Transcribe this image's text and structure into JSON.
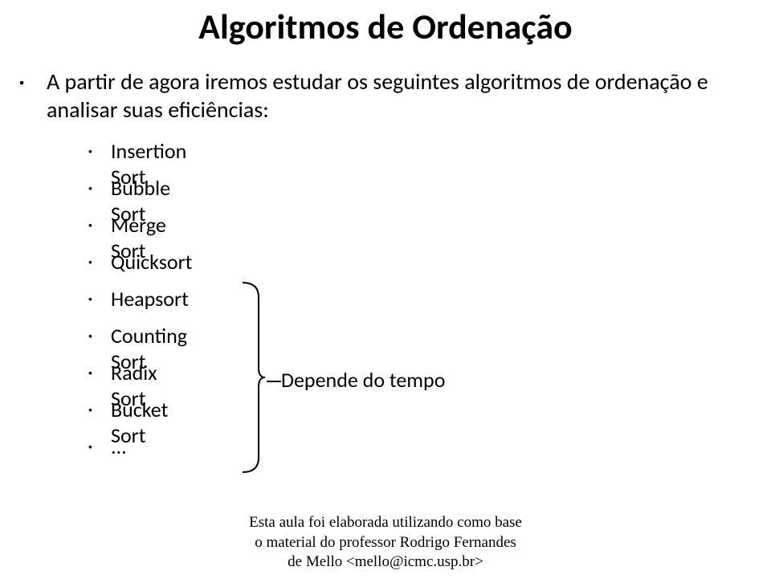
{
  "title": "Algoritmos de Ordenação",
  "intro": "A partir de agora iremos estudar os seguintes algoritmos de ordenação e analisar suas eficiências:",
  "items": [
    "Insertion Sort",
    "Bubble Sort",
    "Merge Sort",
    "Quicksort",
    "Heapsort",
    "Counting Sort",
    "Radix Sort",
    "Bucket Sort",
    "..."
  ],
  "note": "Depende do tempo",
  "footer": {
    "line1": "Esta aula foi elaborada utilizando como base",
    "line2": "o material do professor Rodrigo Fernandes",
    "line3": "de Mello <mello@icmc.usp.br>"
  }
}
